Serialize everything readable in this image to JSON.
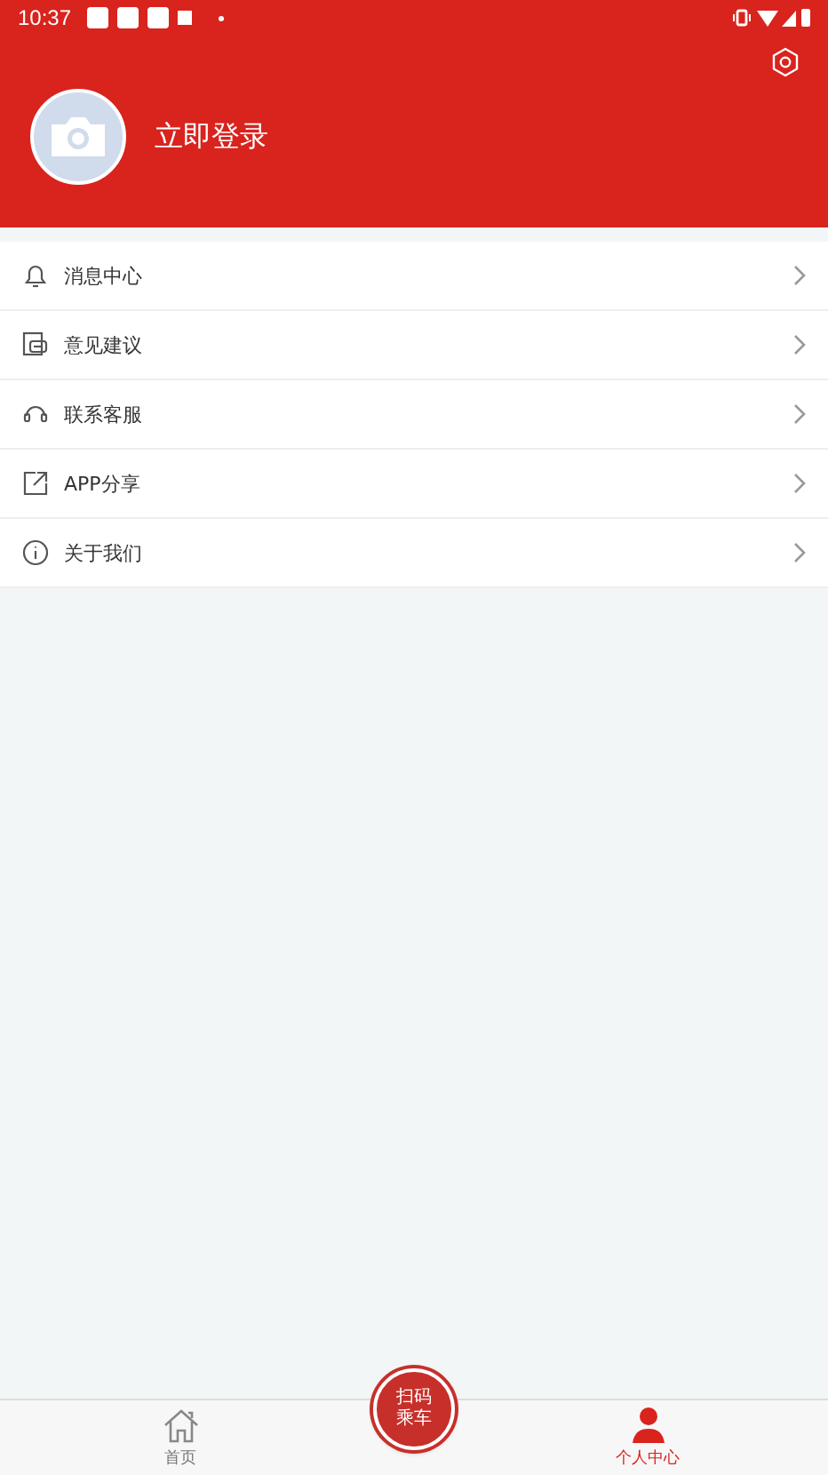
{
  "status_bar": {
    "time": "10:37"
  },
  "profile": {
    "login_label": "立即登录"
  },
  "menu": [
    {
      "kind": "bell",
      "label": "消息中心"
    },
    {
      "kind": "feedback",
      "label": "意见建议"
    },
    {
      "kind": "headset",
      "label": "联系客服"
    },
    {
      "kind": "share",
      "label": "APP分享"
    },
    {
      "kind": "info",
      "label": "关于我们"
    }
  ],
  "scan_button": {
    "lines": [
      "扫码",
      "乘车"
    ]
  },
  "tabs": [
    {
      "kind": "home",
      "label": "首页",
      "selected": false
    },
    {
      "kind": "person",
      "label": "个人中心",
      "selected": true
    }
  ]
}
